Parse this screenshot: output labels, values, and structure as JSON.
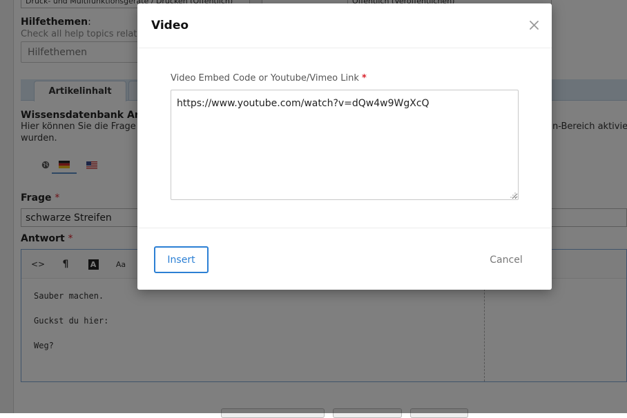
{
  "background": {
    "top_select_left": "Druck- und Multifunktionsgeräte / Drucken (Öffentlich)",
    "top_select_right": "Öffentlich (Veröffentlichen)",
    "help_topics": {
      "label": "Hilfethemen",
      "label_suffix": ":",
      "hint": "Check all help topics relate",
      "placeholder": "Hilfethemen"
    },
    "tabs": [
      {
        "label": "Artikelinhalt"
      }
    ],
    "kb": {
      "title": "Wissensdatenbank Artik",
      "desc_line1": "Hier können Sie die Frage",
      "desc_right": "n-Bereich aktivier",
      "desc_line2": "wurden."
    },
    "languages": [
      "global",
      "de",
      "us"
    ],
    "question": {
      "label": "Frage",
      "required_mark": "*",
      "value": "schwarze Streifen"
    },
    "answer": {
      "label": "Antwort",
      "required_mark": "*",
      "toolbar": {
        "code": "<>",
        "paragraph": "¶",
        "font_color": "A",
        "font_size": "Aa"
      },
      "lines": [
        "Sauber machen.",
        "Guckst du hier:",
        "Weg?"
      ]
    }
  },
  "modal": {
    "title": "Video",
    "close_icon": "close-icon",
    "field_label": "Video Embed Code or Youtube/Vimeo Link",
    "required_mark": "*",
    "field_value": "https://www.youtube.com/watch?v=dQw4w9WgXcQ",
    "insert_label": "Insert",
    "cancel_label": "Cancel",
    "colors": {
      "primary": "#2b7fd4",
      "required": "#d9232d"
    }
  }
}
